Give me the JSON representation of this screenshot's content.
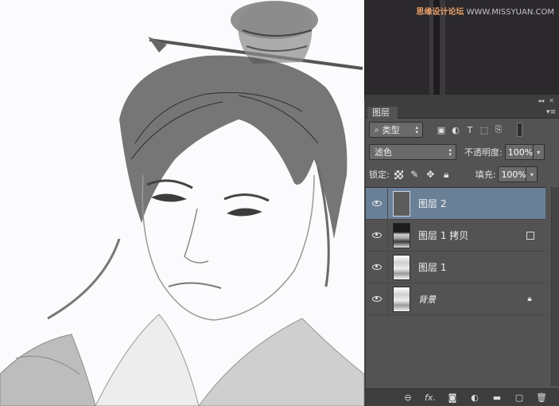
{
  "watermark": {
    "brand": "思缘设计论坛",
    "url": "WWW.MISSYUAN.COM"
  },
  "panel": {
    "tab_label": "图层",
    "collapse_icon": "double-chevron-icon",
    "menu_icon": "panel-menu-icon",
    "filter": {
      "kind_label": "类型",
      "icons": [
        "image-filter-icon",
        "adjustment-filter-icon",
        "type-filter-icon",
        "shape-filter-icon",
        "smart-object-filter-icon"
      ]
    },
    "blend_mode": "滤色",
    "opacity_label": "不透明度:",
    "opacity_value": "100%",
    "lock_label": "锁定:",
    "fill_label": "填充:",
    "fill_value": "100%",
    "layers": [
      {
        "name": "图层 2",
        "selected": true,
        "thumb": "gray",
        "badge": ""
      },
      {
        "name": "图层 1 拷贝",
        "selected": false,
        "thumb": "photo",
        "badge": "link"
      },
      {
        "name": "图层 1",
        "selected": false,
        "thumb": "sketch",
        "badge": ""
      },
      {
        "name": "背景",
        "selected": false,
        "thumb": "sketch",
        "badge": "lock"
      }
    ],
    "bottom_icons": [
      "link-icon",
      "fx-icon",
      "mask-icon",
      "adjustment-icon",
      "group-folder-icon",
      "new-layer-icon",
      "trash-icon"
    ],
    "fx_label": "fx."
  },
  "colors": {
    "selected_layer": "#6a8097",
    "panel_bg": "#535353",
    "canvas_bg": "#fbfafc"
  }
}
